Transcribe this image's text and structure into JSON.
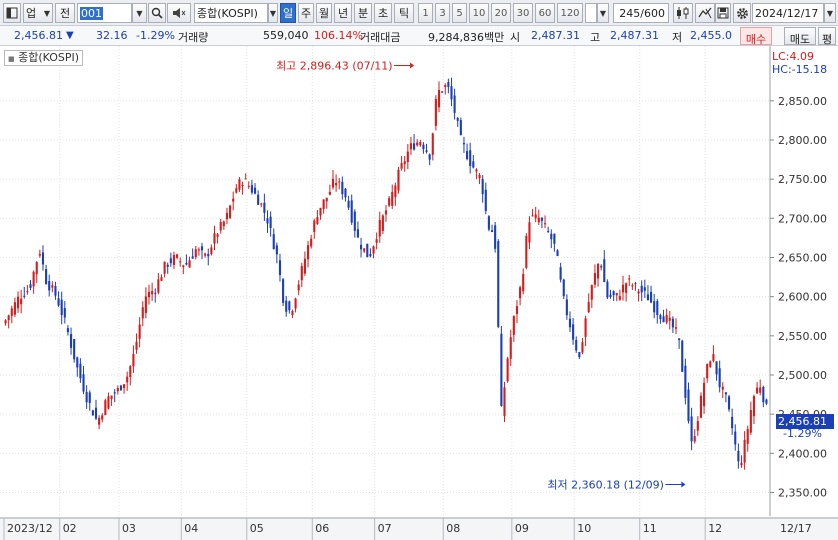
{
  "toolbar": {
    "menu_icon": "window-menu-icon",
    "market": "업",
    "prev_label": "전",
    "code": "001",
    "search_icon": "magnifier-icon",
    "sound_icon": "speaker-icon",
    "index_name": "종합(KOSPI)",
    "periods": [
      "일",
      "주",
      "월",
      "년",
      "분",
      "초",
      "틱"
    ],
    "active_period": "일",
    "intervals": [
      "1",
      "3",
      "5",
      "10",
      "20",
      "30",
      "60",
      "120"
    ],
    "count": "245/600",
    "date": "2024/12/17"
  },
  "quote": {
    "price": "2,456.81",
    "change": "32.16",
    "change_pct": "-1.29%",
    "volume_label": "거래량",
    "volume": "559,040",
    "volume_pct": "106.14%",
    "amount_label": "거래대금",
    "amount": "9,284,836백만",
    "open_label": "시",
    "open": "2,487.31",
    "high_label": "고",
    "high": "2,487.31",
    "low_label": "저",
    "low": "2,455.0",
    "buy_label": "매수",
    "sell_label": "매도",
    "flat_label": "평"
  },
  "chart": {
    "legend": "종합(KOSPI)",
    "lc_text": "LC:4.09",
    "hc_text": "HC:-15.18",
    "high_annotation": "최고 2,896.43 (07/11)",
    "low_annotation": "최저 2,360.18 (12/09)",
    "current_price": "2,456.81",
    "current_pct": "-1.29%",
    "colors": {
      "up": "#d51d1d",
      "down": "#1b3fb5",
      "grid": "#e3e3e3"
    }
  },
  "chart_data": {
    "type": "candlestick",
    "ylim": [
      2320,
      2920
    ],
    "yticks": [
      2350,
      2400,
      2450,
      2500,
      2550,
      2600,
      2650,
      2700,
      2750,
      2800,
      2850
    ],
    "ytick_labels": [
      "2,350.00",
      "2,400.00",
      "2,450.00",
      "2,500.00",
      "2,550.00",
      "2,600.00",
      "2,650.00",
      "2,700.00",
      "2,750.00",
      "2,800.00",
      "2,850.00"
    ],
    "x_labels": [
      "2023/12",
      "02",
      "03",
      "04",
      "05",
      "06",
      "07",
      "08",
      "09",
      "10",
      "11",
      "12",
      "12/17"
    ],
    "close_path": [
      [
        0,
        2570
      ],
      [
        4,
        2600
      ],
      [
        7,
        2610
      ],
      [
        10,
        2660
      ],
      [
        12,
        2620
      ],
      [
        15,
        2600
      ],
      [
        18,
        2560
      ],
      [
        21,
        2510
      ],
      [
        24,
        2470
      ],
      [
        27,
        2440
      ],
      [
        30,
        2470
      ],
      [
        33,
        2480
      ],
      [
        36,
        2500
      ],
      [
        38,
        2530
      ],
      [
        41,
        2600
      ],
      [
        44,
        2610
      ],
      [
        47,
        2640
      ],
      [
        50,
        2650
      ],
      [
        53,
        2640
      ],
      [
        56,
        2660
      ],
      [
        59,
        2650
      ],
      [
        62,
        2680
      ],
      [
        65,
        2700
      ],
      [
        68,
        2740
      ],
      [
        70,
        2750
      ],
      [
        72,
        2740
      ],
      [
        75,
        2720
      ],
      [
        77,
        2700
      ],
      [
        80,
        2650
      ],
      [
        82,
        2590
      ],
      [
        84,
        2580
      ],
      [
        87,
        2630
      ],
      [
        90,
        2680
      ],
      [
        92,
        2710
      ],
      [
        95,
        2730
      ],
      [
        97,
        2750
      ],
      [
        100,
        2730
      ],
      [
        102,
        2700
      ],
      [
        104,
        2670
      ],
      [
        107,
        2650
      ],
      [
        110,
        2690
      ],
      [
        113,
        2720
      ],
      [
        116,
        2760
      ],
      [
        119,
        2790
      ],
      [
        122,
        2800
      ],
      [
        125,
        2780
      ],
      [
        127,
        2860
      ],
      [
        130,
        2870
      ],
      [
        132,
        2840
      ],
      [
        134,
        2800
      ],
      [
        137,
        2770
      ],
      [
        140,
        2750
      ],
      [
        142,
        2690
      ],
      [
        144,
        2680
      ],
      [
        146,
        2450
      ],
      [
        148,
        2530
      ],
      [
        150,
        2580
      ],
      [
        152,
        2620
      ],
      [
        154,
        2700
      ],
      [
        157,
        2700
      ],
      [
        160,
        2680
      ],
      [
        162,
        2660
      ],
      [
        164,
        2600
      ],
      [
        167,
        2550
      ],
      [
        169,
        2520
      ],
      [
        171,
        2580
      ],
      [
        173,
        2620
      ],
      [
        175,
        2650
      ],
      [
        177,
        2600
      ],
      [
        180,
        2600
      ],
      [
        183,
        2620
      ],
      [
        186,
        2610
      ],
      [
        189,
        2600
      ],
      [
        192,
        2580
      ],
      [
        195,
        2570
      ],
      [
        198,
        2550
      ],
      [
        200,
        2480
      ],
      [
        202,
        2410
      ],
      [
        204,
        2450
      ],
      [
        206,
        2500
      ],
      [
        208,
        2530
      ],
      [
        210,
        2490
      ],
      [
        212,
        2470
      ],
      [
        214,
        2430
      ],
      [
        216,
        2380
      ],
      [
        218,
        2420
      ],
      [
        220,
        2470
      ],
      [
        222,
        2490
      ],
      [
        224,
        2456.81
      ]
    ],
    "high": {
      "value": 2896.43,
      "date": "07/11"
    },
    "low": {
      "value": 2360.18,
      "date": "12/09"
    },
    "last": 2456.81
  }
}
